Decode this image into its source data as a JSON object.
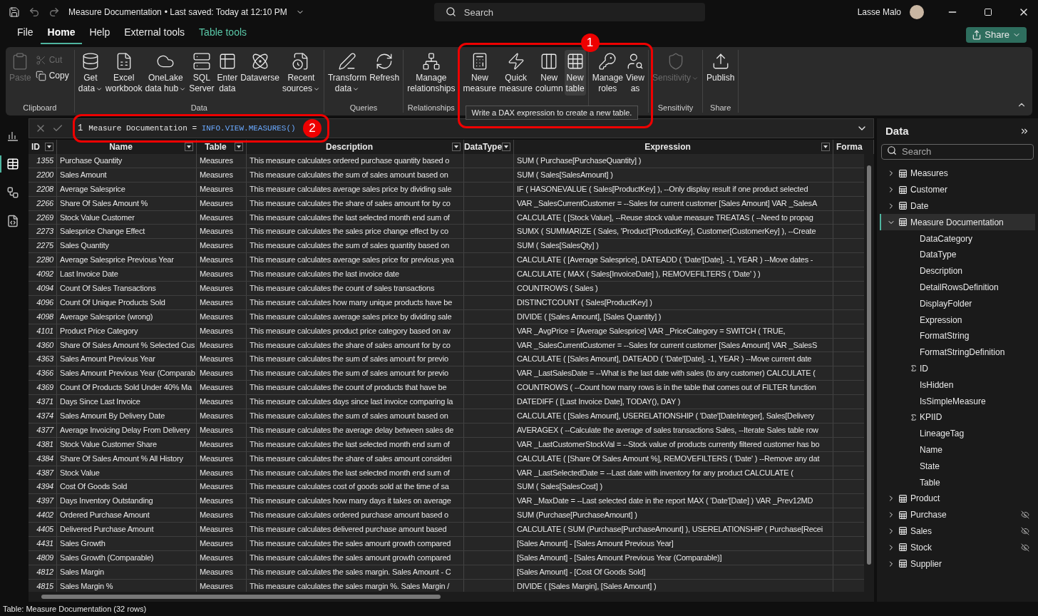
{
  "title_bar": {
    "title": "Measure Documentation",
    "saved": "• Last saved: Today at 12:10 PM",
    "search": {
      "placeholder": "Search"
    },
    "user": "Lasse Malo"
  },
  "tabs": [
    {
      "label": "File",
      "selected": false,
      "kind": "plain"
    },
    {
      "label": "Home",
      "selected": true,
      "kind": "plain"
    },
    {
      "label": "Help",
      "selected": false,
      "kind": "plain"
    },
    {
      "label": "External tools",
      "selected": false,
      "kind": "plain"
    },
    {
      "label": "Table tools",
      "selected": false,
      "kind": "contextual"
    }
  ],
  "share_button": "Share",
  "ribbon": [
    {
      "label": "Clipboard",
      "buttons": [
        {
          "label": "Paste",
          "kind": "large",
          "disabled": true,
          "hovered": false,
          "has_menu": false
        },
        {
          "label": "Cut",
          "kind": "small",
          "disabled": true,
          "hovered": false,
          "has_menu": false
        },
        {
          "label": "Copy",
          "kind": "small",
          "disabled": false,
          "hovered": false,
          "has_menu": false
        }
      ]
    },
    {
      "label": "Data",
      "buttons": [
        {
          "label": "Get data",
          "kind": "large",
          "disabled": false,
          "hovered": false,
          "has_menu": true
        },
        {
          "label": "Excel workbook",
          "kind": "large",
          "disabled": false,
          "hovered": false,
          "has_menu": false
        },
        {
          "label": "OneLake data hub",
          "kind": "large",
          "disabled": false,
          "hovered": false,
          "has_menu": true
        },
        {
          "label": "SQL Server",
          "kind": "large",
          "disabled": false,
          "hovered": false,
          "has_menu": false
        },
        {
          "label": "Enter data",
          "kind": "large",
          "disabled": false,
          "hovered": false,
          "has_menu": false
        },
        {
          "label": "Dataverse",
          "kind": "large",
          "disabled": false,
          "hovered": false,
          "has_menu": false
        },
        {
          "label": "Recent sources",
          "kind": "large",
          "disabled": false,
          "hovered": false,
          "has_menu": true
        }
      ]
    },
    {
      "label": "Queries",
      "buttons": [
        {
          "label": "Transform data",
          "kind": "large",
          "disabled": false,
          "hovered": false,
          "has_menu": true
        },
        {
          "label": "Refresh",
          "kind": "large",
          "disabled": false,
          "hovered": false,
          "has_menu": false
        }
      ]
    },
    {
      "label": "Relationships",
      "buttons": [
        {
          "label": "Manage relationships",
          "kind": "large",
          "disabled": false,
          "hovered": false,
          "has_menu": false
        }
      ]
    },
    {
      "tooltip": "Write a DAX expression to create a new table.",
      "buttons": [
        {
          "label": "New measure",
          "kind": "large",
          "disabled": false,
          "hovered": false,
          "has_menu": false
        },
        {
          "label": "Quick measure",
          "kind": "large",
          "disabled": false,
          "hovered": false,
          "has_menu": false
        },
        {
          "label": "New column",
          "kind": "large",
          "disabled": false,
          "hovered": false,
          "has_menu": false
        },
        {
          "label": "New table",
          "kind": "large",
          "disabled": false,
          "hovered": true,
          "has_menu": false
        }
      ]
    },
    {
      "buttons": [
        {
          "label": "Manage roles",
          "kind": "large",
          "disabled": false,
          "hovered": false,
          "has_menu": false
        },
        {
          "label": "View as",
          "kind": "large",
          "disabled": false,
          "hovered": false,
          "has_menu": false
        }
      ]
    },
    {
      "label": "Sensitivity",
      "buttons": [
        {
          "label": "Sensitivity",
          "kind": "large",
          "disabled": true,
          "hovered": false,
          "has_menu": true
        }
      ]
    },
    {
      "label": "Share",
      "buttons": [
        {
          "label": "Publish",
          "kind": "large",
          "disabled": false,
          "hovered": false,
          "has_menu": false
        }
      ]
    }
  ],
  "rail": [
    {
      "selected": false
    },
    {
      "selected": true
    },
    {
      "selected": false
    },
    {
      "selected": false
    }
  ],
  "formula_bar": {
    "line": "1",
    "name": "Measure Documentation =",
    "function": "INFO.VIEW.MEASURES()"
  },
  "annotations": [
    {
      "number": "1"
    },
    {
      "number": "2"
    }
  ],
  "table": {
    "columns": [
      "ID",
      "Name",
      "Table",
      "Description",
      "DataType",
      "Expression",
      "Forma"
    ],
    "rows": [
      [
        "1355",
        "Purchase Quantity",
        "Measures",
        "This measure calculates ordered purchase quantity based o",
        "SUM ( Purchase[PurchaseQuantity] )"
      ],
      [
        "2200",
        "Sales Amount",
        "Measures",
        "This measure calculates the sum of sales amount based on",
        "SUM ( Sales[SalesAmount] )"
      ],
      [
        "2208",
        "Average Salesprice",
        "Measures",
        "This measure calculates average sales price by dividing sale",
        "IF ( HASONEVALUE ( Sales[ProductKey] ), --Only display result if one product selected"
      ],
      [
        "2266",
        "Share Of Sales Amount %",
        "Measures",
        "This measure calculates the share of sales amount for by co",
        "VAR _SalesCurrentCustomer = --Sales for current customer [Sales Amount] VAR _SalesA"
      ],
      [
        "2269",
        "Stock Value Customer",
        "Measures",
        "This measure calculates the last selected month end sum of",
        "CALCULATE ( [Stock Value], --Reuse stock value measure TREATAS ( --Need to propag"
      ],
      [
        "2273",
        "Salesprice Change Effect",
        "Measures",
        "This measure calculates the sales price change effect by co",
        "SUMX ( SUMMARIZE ( Sales, 'Product'[ProductKey], Customer[CustomerKey] ), --Create"
      ],
      [
        "2275",
        "Sales Quantity",
        "Measures",
        "This measure calculates the sum of sales quantity based on",
        "SUM ( Sales[SalesQty] )"
      ],
      [
        "2280",
        "Average Salesprice Previous Year",
        "Measures",
        "This measure calculates average sales price for previous yea",
        "CALCULATE ( [Average Salesprice], DATEADD ( 'Date'[Date], -1, YEAR ) --Move dates -"
      ],
      [
        "4092",
        "Last Invoice Date",
        "Measures",
        "This measure calculates the last invoice date",
        "CALCULATE ( MAX ( Sales[InvoiceDate] ), REMOVEFILTERS ( 'Date' ) )"
      ],
      [
        "4094",
        "Count Of Sales Transactions",
        "Measures",
        "This measure calculates the count of sales transactions",
        "COUNTROWS ( Sales )"
      ],
      [
        "4096",
        "Count Of Unique Products Sold",
        "Measures",
        "This measure calculates how many unique products have be",
        "DISTINCTCOUNT ( Sales[ProductKey] )"
      ],
      [
        "4098",
        "Average Salesprice (wrong)",
        "Measures",
        "This measure calculates average sales price by dividing sale",
        "DIVIDE ( [Sales Amount], [Sales Quantity] )"
      ],
      [
        "4101",
        "Product Price Category",
        "Measures",
        "This measure calculates product price category based on av",
        "VAR _AvgPrice = [Average Salesprice] VAR _PriceCategory = SWITCH ( TRUE,"
      ],
      [
        "4360",
        "Share Of Sales Amount % Selected Cus",
        "Measures",
        "This measure calculates the share of sales amount for by co",
        "VAR _SalesCurrentCustomer = --Sales for current customer [Sales Amount] VAR _SalesS"
      ],
      [
        "4363",
        "Sales Amount Previous Year",
        "Measures",
        "This measure calculates the sum of sales amount for previo",
        "CALCULATE ( [Sales Amount], DATEADD ( 'Date'[Date], -1, YEAR ) --Move current date"
      ],
      [
        "4366",
        "Sales Amount Previous Year (Comparab",
        "Measures",
        "This measure calculates the sum of sales amount for previo",
        "VAR _LastSalesDate = --What is the last date with sales (to any customer) CALCULATE ("
      ],
      [
        "4369",
        "Count Of Products Sold Under 40% Ma",
        "Measures",
        "This measure calculates the count of products that have be",
        "COUNTROWS ( --Count how many rows is in the table that comes out of FILTER function"
      ],
      [
        "4371",
        "Days Since Last Invoice",
        "Measures",
        "This measure calculates days since last invoice comparing la",
        "DATEDIFF ( [Last Invoice Date], TODAY(), DAY )"
      ],
      [
        "4374",
        "Sales Amount By Delivery Date",
        "Measures",
        "This measure calculates the sum of sales amount based on",
        "CALCULATE ( [Sales Amount], USERELATIONSHIP ( 'Date'[DateInteger], Sales[Delivery"
      ],
      [
        "4377",
        "Average Invoicing Delay From Delivery",
        "Measures",
        "This measure calculates the average delay between sales de",
        "AVERAGEX ( --Calculate the average of sales transactions Sales, --Iterate Sales table row"
      ],
      [
        "4381",
        "Stock Value Customer Share",
        "Measures",
        "This measure calculates the last selected month end sum of",
        "VAR _LastCustomerStockVal = --Stock value of products currently filtered customer has bo"
      ],
      [
        "4384",
        "Share Of Sales Amount % All History",
        "Measures",
        "This measure calculates the share of sales amount consideri",
        "CALCULATE ( [Share Of Sales Amount %], REMOVEFILTERS ( 'Date' ) --Remove any dat"
      ],
      [
        "4387",
        "Stock Value",
        "Measures",
        "This measure calculates the last selected month end sum of",
        "VAR _LastSelectedDate = --Last date with inventory for any product CALCULATE ("
      ],
      [
        "4394",
        "Cost Of Goods Sold",
        "Measures",
        "This measure calculates cost of goods sold at the time of sa",
        "SUM ( Sales[SalesCost] )"
      ],
      [
        "4397",
        "Days Inventory Outstanding",
        "Measures",
        "This measure calculates how many days it takes on average",
        "VAR _MaxDate = --Last selected date in the report MAX ( 'Date'[Date] ) VAR _Prev12MD"
      ],
      [
        "4402",
        "Ordered Purchase Amount",
        "Measures",
        "This measure calculates ordered purchase amount based o",
        "SUM (Purchase[PurchaseAmount] )"
      ],
      [
        "4405",
        "Delivered Purchase Amount",
        "Measures",
        "This measure calculates delivered purchase amount based",
        "CALCULATE ( SUM (Purchase[PurchaseAmount] ), USERELATIONSHIP ( Purchase[Recei"
      ],
      [
        "4431",
        "Sales Growth",
        "Measures",
        "This measure calculates the sales amount growth compared",
        "[Sales Amount] - [Sales Amount Previous Year]"
      ],
      [
        "4809",
        "Sales Growth (Comparable)",
        "Measures",
        "This measure calculates the sales amount growth compared",
        "[Sales Amount] - [Sales Amount Previous Year (Comparable)]"
      ],
      [
        "4812",
        "Sales Margin",
        "Measures",
        "This measure calculates the sales margin. Sales Amount - C",
        "[Sales Amount] - [Cost Of Goods Sold]"
      ],
      [
        "4815",
        "Sales Margin %",
        "Measures",
        "This measure calculates the sales margin %. Sales Margin /",
        "DIVIDE ( [Sales Margin], [Sales Amount] )"
      ]
    ]
  },
  "data_pane": {
    "title": "Data",
    "search": {
      "placeholder": "Search"
    },
    "tables": [
      {
        "name": "Measures",
        "expanded": false,
        "selected": false,
        "hidden": false
      },
      {
        "name": "Customer",
        "expanded": false,
        "selected": false,
        "hidden": false
      },
      {
        "name": "Date",
        "expanded": false,
        "selected": false,
        "hidden": false
      },
      {
        "name": "Measure Documentation",
        "expanded": true,
        "selected": true,
        "hidden": false,
        "children": [
          {
            "name": "DataCategory",
            "kind": "field"
          },
          {
            "name": "DataType",
            "kind": "field"
          },
          {
            "name": "Description",
            "kind": "field"
          },
          {
            "name": "DetailRowsDefinition",
            "kind": "field"
          },
          {
            "name": "DisplayFolder",
            "kind": "field"
          },
          {
            "name": "Expression",
            "kind": "field"
          },
          {
            "name": "FormatString",
            "kind": "field"
          },
          {
            "name": "FormatStringDefinition",
            "kind": "field"
          },
          {
            "name": "ID",
            "kind": "sum"
          },
          {
            "name": "IsHidden",
            "kind": "field"
          },
          {
            "name": "IsSimpleMeasure",
            "kind": "field"
          },
          {
            "name": "KPIID",
            "kind": "sum"
          },
          {
            "name": "LineageTag",
            "kind": "field"
          },
          {
            "name": "Name",
            "kind": "field"
          },
          {
            "name": "State",
            "kind": "field"
          },
          {
            "name": "Table",
            "kind": "field"
          }
        ]
      },
      {
        "name": "Product",
        "expanded": false,
        "selected": false,
        "hidden": false
      },
      {
        "name": "Purchase",
        "expanded": false,
        "selected": false,
        "hidden": true
      },
      {
        "name": "Sales",
        "expanded": false,
        "selected": false,
        "hidden": true
      },
      {
        "name": "Stock",
        "expanded": false,
        "selected": false,
        "hidden": true
      },
      {
        "name": "Supplier",
        "expanded": false,
        "selected": false,
        "hidden": false
      }
    ]
  },
  "status_bar": "Table: Measure Documentation (32 rows)"
}
